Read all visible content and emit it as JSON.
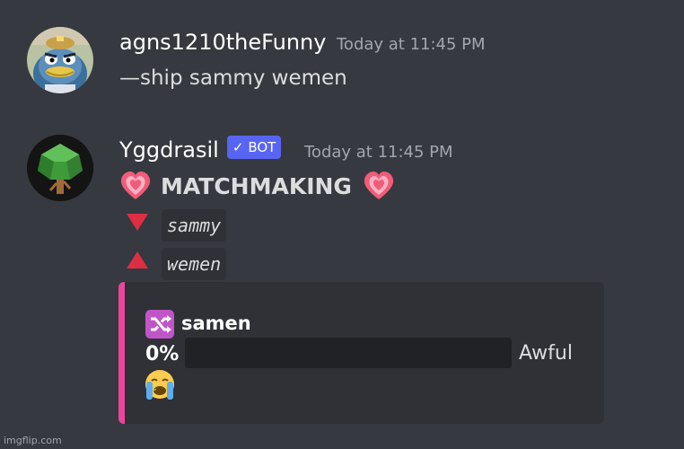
{
  "messages": [
    {
      "username": "agns1210theFunny",
      "timestamp": "Today at 11:45 PM",
      "text": "—ship sammy wemen",
      "avatar_icon": "penguin-avatar"
    },
    {
      "username": "Yggdrasil",
      "bot_tag": "✓ BOT",
      "timestamp": "Today at 11:45 PM",
      "avatar_icon": "tree-avatar",
      "title": "MATCHMAKING",
      "name_down": "sammy",
      "name_up": "wemen",
      "embed": {
        "author": "samen",
        "percent": "0%",
        "progress": 0,
        "rating": "Awful",
        "accent": "#eb459e",
        "icon": "shuffle-icon",
        "emoji": "loudly-crying-face-icon"
      }
    }
  ],
  "watermark": "imgflip.com"
}
